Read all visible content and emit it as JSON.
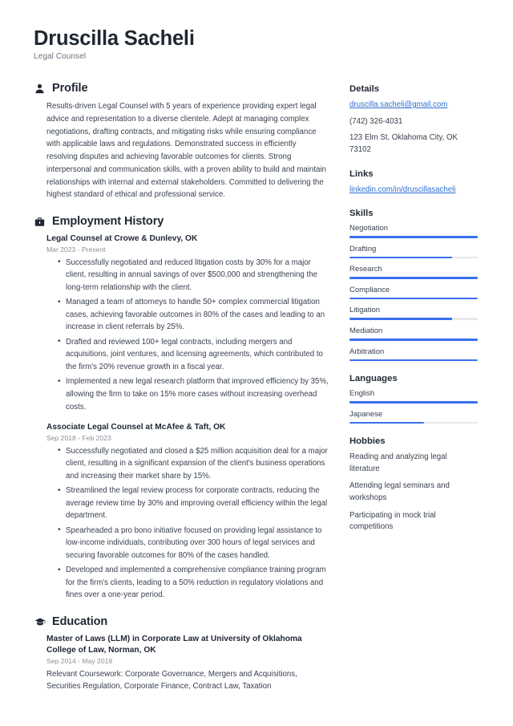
{
  "header": {
    "full_name": "Druscilla Sacheli",
    "job_title": "Legal Counsel"
  },
  "accent_color": "#3b6ff0",
  "link_color": "#2f6fd0",
  "sections": {
    "profile": {
      "title": "Profile",
      "icon": "user-icon",
      "text": "Results-driven Legal Counsel with 5 years of experience providing expert legal advice and representation to a diverse clientele. Adept at managing complex negotiations, drafting contracts, and mitigating risks while ensuring compliance with applicable laws and regulations. Demonstrated success in efficiently resolving disputes and achieving favorable outcomes for clients. Strong interpersonal and communication skills, with a proven ability to build and maintain relationships with internal and external stakeholders. Committed to delivering the highest standard of ethical and professional service."
    },
    "employment": {
      "title": "Employment History",
      "icon": "briefcase-icon",
      "entries": [
        {
          "title": "Legal Counsel at Crowe & Dunlevy, OK",
          "date": "Mar 2023 - Present",
          "bullets": [
            "Successfully negotiated and reduced litigation costs by 30% for a major client, resulting in annual savings of over $500,000 and strengthening the long-term relationship with the client.",
            "Managed a team of attorneys to handle 50+ complex commercial litigation cases, achieving favorable outcomes in 80% of the cases and leading to an increase in client referrals by 25%.",
            "Drafted and reviewed 100+ legal contracts, including mergers and acquisitions, joint ventures, and licensing agreements, which contributed to the firm's 20% revenue growth in a fiscal year.",
            "Implemented a new legal research platform that improved efficiency by 35%, allowing the firm to take on 15% more cases without increasing overhead costs."
          ]
        },
        {
          "title": "Associate Legal Counsel at McAfee & Taft, OK",
          "date": "Sep 2018 - Feb 2023",
          "bullets": [
            "Successfully negotiated and closed a $25 million acquisition deal for a major client, resulting in a significant expansion of the client's business operations and increasing their market share by 15%.",
            "Streamlined the legal review process for corporate contracts, reducing the average review time by 30% and improving overall efficiency within the legal department.",
            "Spearheaded a pro bono initiative focused on providing legal assistance to low-income individuals, contributing over 300 hours of legal services and securing favorable outcomes for 80% of the cases handled.",
            "Developed and implemented a comprehensive compliance training program for the firm's clients, leading to a 50% reduction in regulatory violations and fines over a one-year period."
          ]
        }
      ]
    },
    "education": {
      "title": "Education",
      "icon": "graduation-cap-icon",
      "entries": [
        {
          "title": "Master of Laws (LLM) in Corporate Law at University of Oklahoma College of Law, Norman, OK",
          "date": "Sep 2014 - May 2018",
          "note": "Relevant Coursework: Corporate Governance, Mergers and Acquisitions, Securities Regulation, Corporate Finance, Contract Law, Taxation"
        }
      ]
    }
  },
  "sidebar": {
    "details": {
      "title": "Details",
      "email": "druscilla.sacheli@gmail.com",
      "phone": "(742) 326-4031",
      "address": "123 Elm St, Oklahoma City, OK 73102"
    },
    "links": {
      "title": "Links",
      "items": [
        {
          "label": "linkedin.com/in/druscillasacheli"
        }
      ]
    },
    "skills": {
      "title": "Skills",
      "items": [
        {
          "label": "Negotiation",
          "level": 100
        },
        {
          "label": "Drafting",
          "level": 80
        },
        {
          "label": "Research",
          "level": 100
        },
        {
          "label": "Compliance",
          "level": 100
        },
        {
          "label": "Litigation",
          "level": 80
        },
        {
          "label": "Mediation",
          "level": 100
        },
        {
          "label": "Arbitration",
          "level": 100
        }
      ]
    },
    "languages": {
      "title": "Languages",
      "items": [
        {
          "label": "English",
          "level": 100
        },
        {
          "label": "Japanese",
          "level": 58
        }
      ]
    },
    "hobbies": {
      "title": "Hobbies",
      "items": [
        {
          "label": "Reading and analyzing legal literature"
        },
        {
          "label": "Attending legal seminars and workshops"
        },
        {
          "label": "Participating in mock trial competitions"
        }
      ]
    }
  }
}
